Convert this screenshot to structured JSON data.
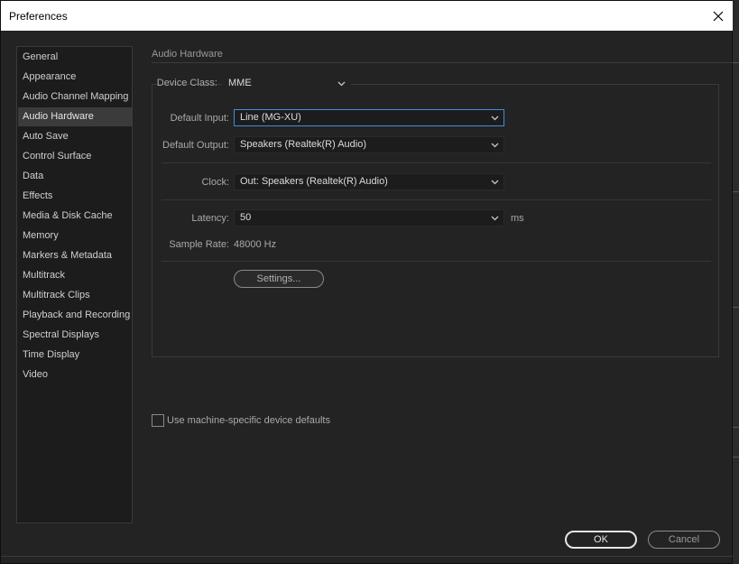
{
  "window": {
    "title": "Preferences"
  },
  "sidebar": {
    "items": [
      {
        "label": "General"
      },
      {
        "label": "Appearance"
      },
      {
        "label": "Audio Channel Mapping"
      },
      {
        "label": "Audio Hardware",
        "selected": true
      },
      {
        "label": "Auto Save"
      },
      {
        "label": "Control Surface"
      },
      {
        "label": "Data"
      },
      {
        "label": "Effects"
      },
      {
        "label": "Media & Disk Cache"
      },
      {
        "label": "Memory"
      },
      {
        "label": "Markers & Metadata"
      },
      {
        "label": "Multitrack"
      },
      {
        "label": "Multitrack Clips"
      },
      {
        "label": "Playback and Recording"
      },
      {
        "label": "Spectral Displays"
      },
      {
        "label": "Time Display"
      },
      {
        "label": "Video"
      }
    ]
  },
  "section": {
    "title": "Audio Hardware"
  },
  "device_class": {
    "label": "Device Class:",
    "value": "MME"
  },
  "default_input": {
    "label": "Default Input:",
    "value": "Line (MG-XU)"
  },
  "default_output": {
    "label": "Default Output:",
    "value": "Speakers (Realtek(R) Audio)"
  },
  "clock": {
    "label": "Clock:",
    "value": "Out: Speakers (Realtek(R) Audio)"
  },
  "latency": {
    "label": "Latency:",
    "value": "50",
    "unit": "ms"
  },
  "sample_rate": {
    "label": "Sample Rate:",
    "value": "48000 Hz"
  },
  "settings_button": {
    "label": "Settings..."
  },
  "machine_defaults": {
    "label": "Use machine-specific device defaults",
    "checked": false
  },
  "footer": {
    "ok_label": "OK",
    "cancel_label": "Cancel"
  },
  "colors": {
    "focus_border": "#3d8ee0",
    "selected_bg": "#3b3b3b",
    "panel_bg": "#232323"
  }
}
